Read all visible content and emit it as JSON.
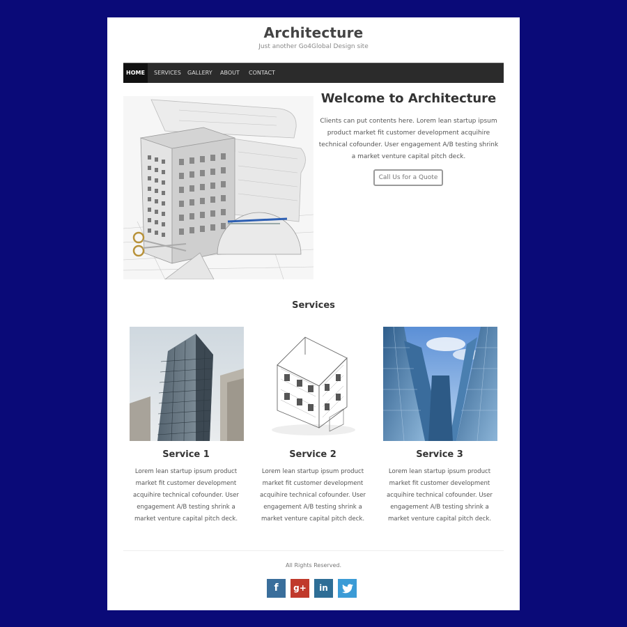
{
  "header": {
    "title": "Architecture",
    "tagline": "Just another Go4Global Design site"
  },
  "nav": {
    "items": [
      {
        "label": "HOME",
        "active": true
      },
      {
        "label": "SERVICES",
        "active": false
      },
      {
        "label": "GALLERY",
        "active": false
      },
      {
        "label": "ABOUT",
        "active": false
      },
      {
        "label": "CONTACT",
        "active": false
      }
    ]
  },
  "hero": {
    "heading": "Welcome to Architecture",
    "text": "Clients can put contents here. Lorem lean startup ipsum product market fit customer development acquihire technical cofounder. User engagement A/B testing shrink a market venture capital pitch deck.",
    "button_label": "Call Us for a Quote"
  },
  "services": {
    "heading": "Services",
    "items": [
      {
        "title": "Service 1",
        "text": "Lorem lean startup ipsum product market fit customer development acquihire technical cofounder. User engagement A/B testing shrink a market venture capital pitch deck."
      },
      {
        "title": "Service 2",
        "text": "Lorem lean startup ipsum product market fit customer development acquihire technical cofounder. User engagement A/B testing shrink a market venture capital pitch deck."
      },
      {
        "title": "Service 3",
        "text": "Lorem lean startup ipsum product market fit customer development acquihire technical cofounder. User engagement A/B testing shrink a market venture capital pitch deck."
      }
    ]
  },
  "footer": {
    "text": "All Rights Reserved.",
    "social": [
      {
        "icon": "facebook-icon",
        "glyph": "f",
        "color": "#3a6e9b"
      },
      {
        "icon": "google-plus-icon",
        "glyph": "g+",
        "color": "#c0392b"
      },
      {
        "icon": "linkedin-icon",
        "glyph": "in",
        "color": "#2e6e96"
      },
      {
        "icon": "twitter-icon",
        "glyph": "t",
        "color": "#3b9bd6"
      }
    ]
  },
  "colors": {
    "background": "#0a0a78",
    "navbar": "#2b2b2b"
  }
}
